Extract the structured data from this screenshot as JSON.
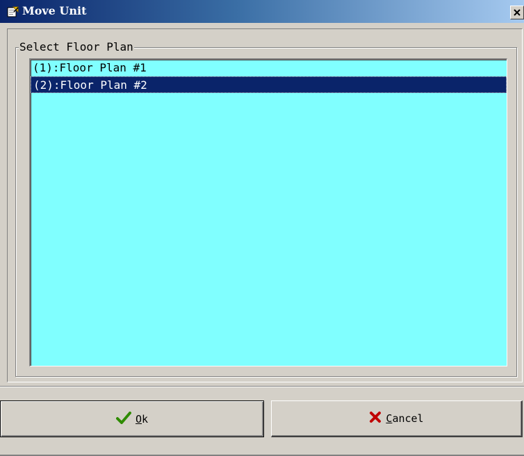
{
  "window": {
    "title": "Move Unit",
    "icon": "move-unit-icon"
  },
  "group": {
    "legend": "Select Floor Plan"
  },
  "floor_plans": [
    {
      "label": "(1):Floor Plan #1",
      "selected": false
    },
    {
      "label": "(2):Floor Plan #2",
      "selected": true
    }
  ],
  "buttons": {
    "ok": {
      "accel": "O",
      "rest": "k",
      "icon": "checkmark-icon"
    },
    "cancel": {
      "accel": "C",
      "rest": "ancel",
      "icon": "x-mark-icon"
    }
  },
  "colors": {
    "list_background": "#80ffff",
    "selection": "#0a246a",
    "ok_icon": "#2e8b00",
    "cancel_icon": "#c00000"
  }
}
